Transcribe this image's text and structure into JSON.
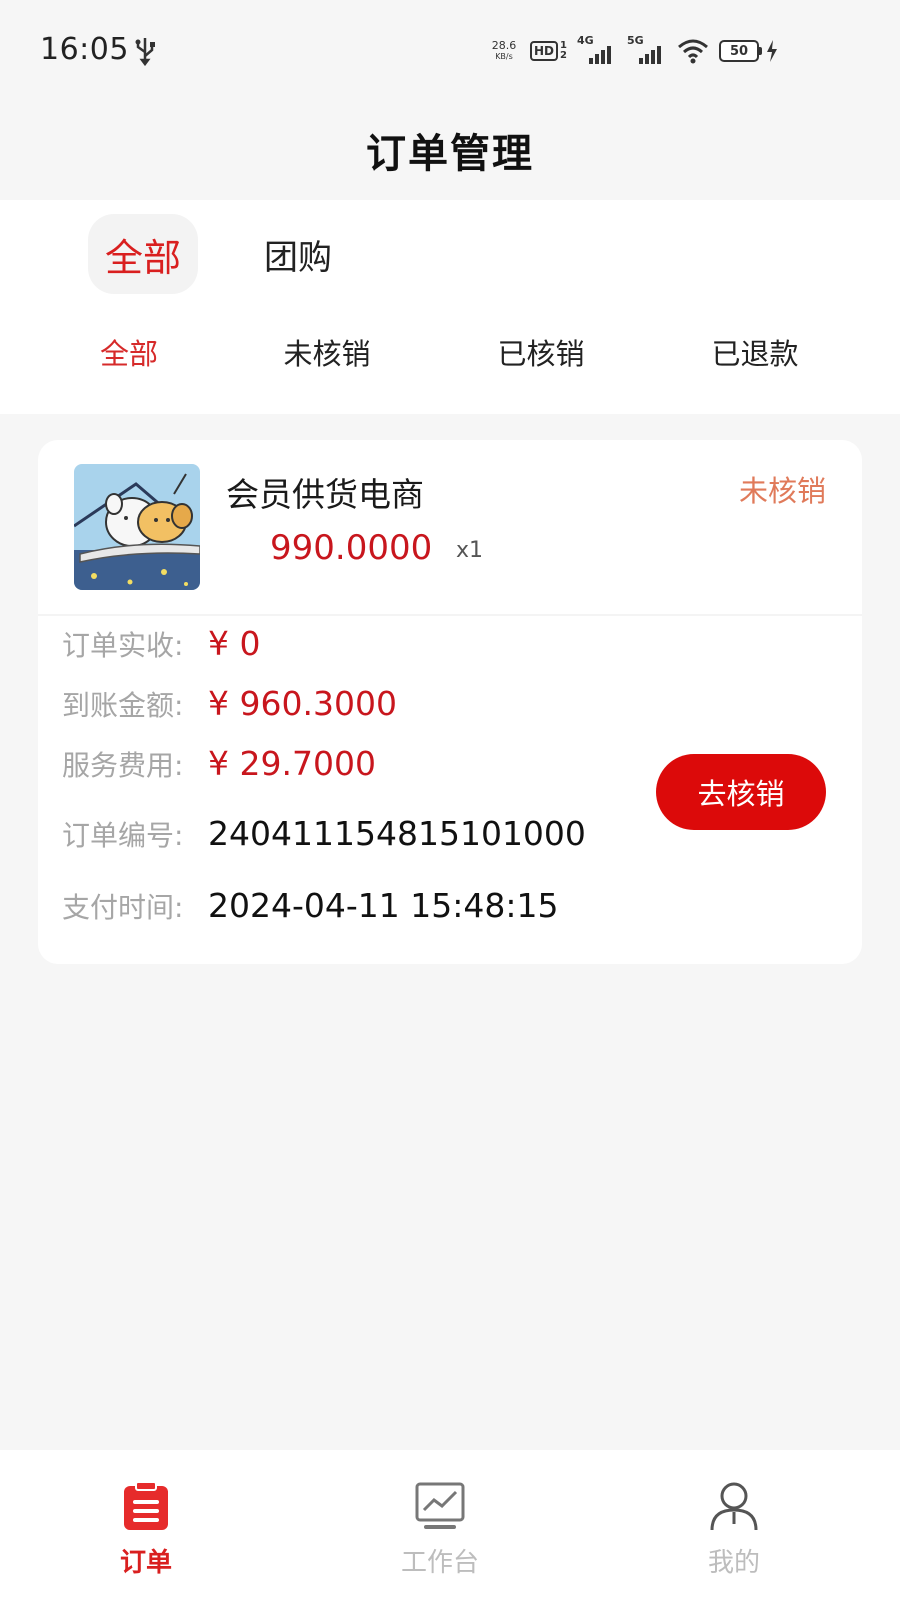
{
  "status_bar": {
    "time": "16:05",
    "net_speed_value": "28.6",
    "net_speed_unit": "KB/s",
    "hd_label": "HD",
    "hd_sub_top": "1",
    "hd_sub_bottom": "2",
    "sim1_gen": "4G",
    "sim2_gen": "5G",
    "battery": "50"
  },
  "header": {
    "title": "订单管理"
  },
  "type_tabs": [
    {
      "label": "全部",
      "active": true
    },
    {
      "label": "团购",
      "active": false
    }
  ],
  "status_tabs": [
    {
      "label": "全部",
      "active": true
    },
    {
      "label": "未核销",
      "active": false
    },
    {
      "label": "已核销",
      "active": false
    },
    {
      "label": "已退款",
      "active": false
    }
  ],
  "order": {
    "product_name": "会员供货电商",
    "status": "未核销",
    "unit_price": "990.0000",
    "quantity": "x1",
    "rows": [
      {
        "label": "订单实收:",
        "value": "¥ 0"
      },
      {
        "label": "到账金额:",
        "value": "¥ 960.3000"
      },
      {
        "label": "服务费用:",
        "value": "¥ 29.7000"
      },
      {
        "label": "订单编号:",
        "value": "240411154815101000"
      },
      {
        "label": "支付时间:",
        "value": "2024-04-11 15:48:15"
      }
    ],
    "action_label": "去核销"
  },
  "bottom_nav": [
    {
      "label": "订单",
      "icon": "clipboard-icon",
      "active": true
    },
    {
      "label": "工作台",
      "icon": "chart-monitor-icon",
      "active": false
    },
    {
      "label": "我的",
      "icon": "user-icon",
      "active": false
    }
  ],
  "colors": {
    "accent": "#d91f1f",
    "price": "#c8161d",
    "status_pending": "#e07a5a",
    "button": "#dc0a0a"
  }
}
